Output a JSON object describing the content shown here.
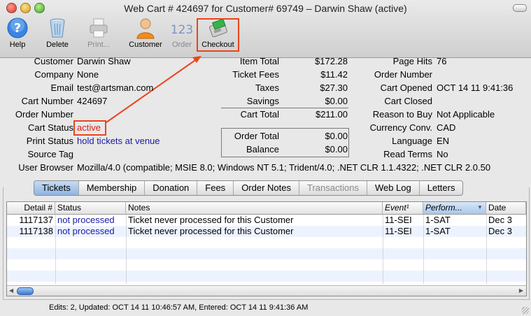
{
  "window": {
    "title": "Web Cart # 424697 for Customer# 69749 – Darwin Shaw (active)"
  },
  "toolbar": {
    "help": "Help",
    "delete": "Delete",
    "print": "Print...",
    "customer": "Customer",
    "order": "Order",
    "order_icon_text": "123",
    "checkout": "Checkout"
  },
  "customer_info": {
    "customer_label": "Customer",
    "customer_value": "Darwin Shaw",
    "company_label": "Company",
    "company_value": "None",
    "email_label": "Email",
    "email_value": "test@artsman.com",
    "cart_number_label": "Cart Number",
    "cart_number_value": "424697",
    "order_number_label": "Order Number",
    "order_number_value": "",
    "cart_status_label": "Cart Status",
    "cart_status_value": "active",
    "print_status_label": "Print Status",
    "print_status_value": "hold tickets at venue",
    "source_tag_label": "Source Tag",
    "source_tag_value": "",
    "user_browser_label": "User Browser",
    "user_browser_value": "Mozilla/4.0 (compatible; MSIE 8.0; Windows NT 5.1; Trident/4.0; .NET CLR 1.1.4322; .NET CLR 2.0.50"
  },
  "totals": {
    "item_total_label": "Item Total",
    "item_total_value": "$172.28",
    "ticket_fees_label": "Ticket Fees",
    "ticket_fees_value": "$11.42",
    "taxes_label": "Taxes",
    "taxes_value": "$27.30",
    "savings_label": "Savings",
    "savings_value": "$0.00",
    "cart_total_label": "Cart Total",
    "cart_total_value": "$211.00",
    "order_total_label": "Order Total",
    "order_total_value": "$0.00",
    "balance_label": "Balance",
    "balance_value": "$0.00"
  },
  "meta": {
    "page_hits_label": "Page Hits",
    "page_hits_value": "76",
    "order_number_label": "Order Number",
    "order_number_value": "",
    "cart_opened_label": "Cart Opened",
    "cart_opened_value": "OCT 14 11 9:41:36",
    "cart_closed_label": "Cart Closed",
    "cart_closed_value": "",
    "reason_label": "Reason to Buy",
    "reason_value": "Not Applicable",
    "currency_label": "Currency Conv.",
    "currency_value": "CAD",
    "language_label": "Language",
    "language_value": "EN",
    "read_terms_label": "Read Terms",
    "read_terms_value": "No"
  },
  "tabs": [
    "Tickets",
    "Membership",
    "Donation",
    "Fees",
    "Order Notes",
    "Transactions",
    "Web Log",
    "Letters"
  ],
  "table": {
    "headers": [
      "Detail #",
      "Status",
      "Notes",
      "Event¹",
      "Perform...",
      "Date"
    ],
    "rows": [
      [
        "1117137",
        "not processed",
        "Ticket never processed for this Customer",
        "11-SEI",
        "1-SAT",
        "Dec 3"
      ],
      [
        "1117138",
        "not processed",
        "Ticket never processed for this Customer",
        "11-SEI",
        "1-SAT",
        "Dec 3"
      ]
    ]
  },
  "status_bar": "Edits: 2, Updated: OCT 14 11 10:46:57 AM, Entered: OCT 14 11 9:41:36 AM",
  "colors": {
    "accent_blue": "#1a1aa6",
    "status_red": "#d6201a",
    "highlight_orange": "#e8451c"
  }
}
